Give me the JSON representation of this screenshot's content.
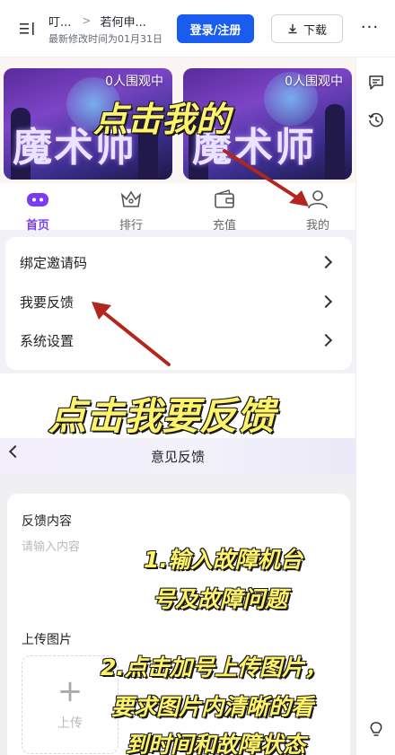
{
  "topbar": {
    "crumb_root": "叮...",
    "crumb_doc": "若何申...",
    "last_modified": "最新修改时间为01月31日",
    "login_label": "登录/注册",
    "download_label": "下载",
    "more_label": "···"
  },
  "rail": {
    "icons": [
      "comment-icon",
      "history-icon",
      "lightbulb-icon"
    ]
  },
  "game_cards": [
    {
      "viewers": "0人围观中",
      "title": "魔术师"
    },
    {
      "viewers": "0人围观中",
      "title": "魔术师"
    }
  ],
  "app_nav": [
    {
      "label": "首页",
      "icon": "home-icon",
      "active": true
    },
    {
      "label": "排行",
      "icon": "crown-icon",
      "active": false
    },
    {
      "label": "充值",
      "icon": "wallet-icon",
      "active": false
    },
    {
      "label": "我的",
      "icon": "user-icon",
      "active": false
    }
  ],
  "menu": [
    {
      "label": "绑定邀请码"
    },
    {
      "label": "我要反馈"
    },
    {
      "label": "系统设置"
    }
  ],
  "captions": {
    "click_mine": "点击我的",
    "click_feedback": "点击我要反馈",
    "step1_line1": "1.输入故障机台",
    "step1_line2": "号及故障问题",
    "step2_line1": "2.点击加号上传图片，",
    "step2_line2": "要求图片内清晰的看",
    "step2_line3": "到时间和故障状态"
  },
  "feedback": {
    "page_title": "意见反馈",
    "content_label": "反馈内容",
    "content_placeholder": "请输入内容",
    "upload_label": "上传图片",
    "upload_button": "上传"
  },
  "colors": {
    "accent": "#1a5cf0",
    "app_purple": "#7a3cf0",
    "caption_yellow": "#fff36a",
    "arrow_red": "#b3261e"
  }
}
